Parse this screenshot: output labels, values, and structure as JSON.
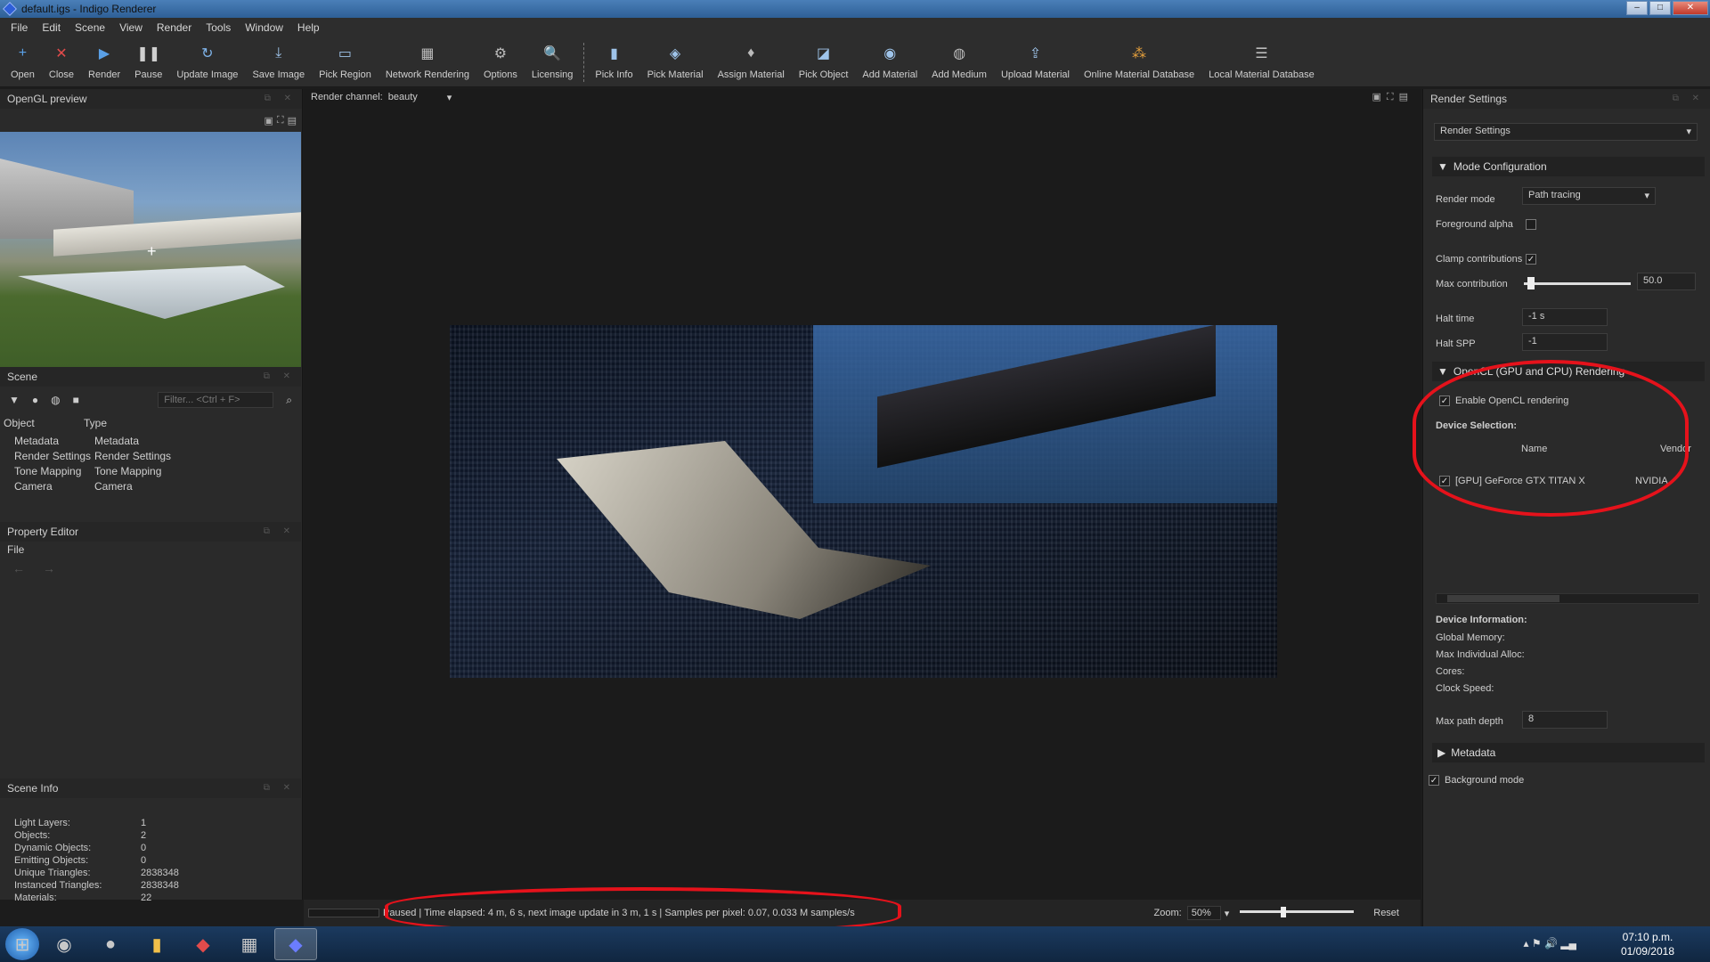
{
  "window": {
    "title": "default.igs - Indigo Renderer",
    "min": "–",
    "max": "□",
    "close": "✕"
  },
  "menu": [
    "File",
    "Edit",
    "Scene",
    "View",
    "Render",
    "Tools",
    "Window",
    "Help"
  ],
  "toolbar": [
    {
      "label": "Open",
      "icon": "plus-icon",
      "glyph": "+",
      "color": "#5aa0e6"
    },
    {
      "label": "Close",
      "icon": "close-icon",
      "glyph": "✕",
      "color": "#e24b4b"
    },
    {
      "label": "Render",
      "icon": "play-icon",
      "glyph": "▶",
      "color": "#5aa0e6"
    },
    {
      "label": "Pause",
      "icon": "pause-icon",
      "glyph": "❚❚",
      "color": "#cfcfcf"
    },
    {
      "label": "Update Image",
      "icon": "refresh-icon",
      "glyph": "↻",
      "color": "#7fb4ea"
    },
    {
      "label": "Save Image",
      "icon": "save-icon",
      "glyph": "⤓",
      "color": "#9fc4ea"
    },
    {
      "label": "Pick Region",
      "icon": "region-icon",
      "glyph": "▭",
      "color": "#9fc4ea"
    },
    {
      "label": "Network Rendering",
      "icon": "network-icon",
      "glyph": "▦",
      "color": "#bbb"
    },
    {
      "label": "Options",
      "icon": "gear-icon",
      "glyph": "⚙",
      "color": "#bbb"
    },
    {
      "label": "Licensing",
      "icon": "key-icon",
      "glyph": "🔍",
      "color": "#9fc4ea"
    },
    {
      "label": "Pick Info",
      "icon": "bar-chart-icon",
      "glyph": "▮",
      "color": "#9fc4ea"
    },
    {
      "label": "Pick Material",
      "icon": "material-icon",
      "glyph": "◈",
      "color": "#9fc4ea"
    },
    {
      "label": "Assign Material",
      "icon": "bucket-icon",
      "glyph": "♦",
      "color": "#bbb"
    },
    {
      "label": "Pick Object",
      "icon": "object-icon",
      "glyph": "◪",
      "color": "#9fc4ea"
    },
    {
      "label": "Add Material",
      "icon": "add-material-icon",
      "glyph": "◉",
      "color": "#9fc4ea"
    },
    {
      "label": "Add Medium",
      "icon": "add-medium-icon",
      "glyph": "◍",
      "color": "#bbb"
    },
    {
      "label": "Upload Material",
      "icon": "upload-icon",
      "glyph": "⇪",
      "color": "#9fc4ea"
    },
    {
      "label": "Online Material Database",
      "icon": "grid-icon",
      "glyph": "⁂",
      "color": "#e6a03c"
    },
    {
      "label": "Local Material Database",
      "icon": "database-icon",
      "glyph": "☰",
      "color": "#bbb"
    }
  ],
  "left": {
    "opengl_title": "OpenGL preview",
    "scene_title": "Scene",
    "filter_placeholder": "Filter... <Ctrl + F>",
    "scene_cols": [
      "Object",
      "Type"
    ],
    "scene_rows": [
      [
        "Metadata",
        "Metadata"
      ],
      [
        "Render Settings",
        "Render Settings"
      ],
      [
        "Tone Mapping",
        "Tone Mapping"
      ],
      [
        "Camera",
        "Camera"
      ]
    ],
    "property_title": "Property Editor",
    "property_file": "File",
    "sceneinfo_title": "Scene Info",
    "sceneinfo": [
      [
        "Light Layers:",
        "1"
      ],
      [
        "Objects:",
        "2"
      ],
      [
        "Dynamic Objects:",
        "0"
      ],
      [
        "Emitting Objects:",
        "0"
      ],
      [
        "Unique Triangles:",
        "2838348"
      ],
      [
        "Instanced Triangles:",
        "2838348"
      ],
      [
        "Materials:",
        "22"
      ]
    ]
  },
  "center": {
    "channel_label": "Render channel:",
    "channel_value": "beauty",
    "status": "Paused | Time elapsed: 4 m, 6 s, next image update in 3 m, 1 s | Samples per pixel: 0.07, 0.033 M samples/s",
    "zoom_label": "Zoom:",
    "zoom_value": "50%",
    "reset": "Reset"
  },
  "right": {
    "title": "Render Settings",
    "preset": "Render Settings",
    "mode_section": "Mode Configuration",
    "render_mode_label": "Render mode",
    "render_mode": "Path tracing",
    "fg_alpha_label": "Foreground alpha",
    "clamp_label": "Clamp contributions",
    "max_contrib_label": "Max contribution",
    "max_contrib": "50.0",
    "halt_time_label": "Halt time",
    "halt_time": "-1 s",
    "halt_spp_label": "Halt SPP",
    "halt_spp": "-1",
    "opencl_section": "OpenCL (GPU and CPU) Rendering",
    "enable_opencl": "Enable OpenCL rendering",
    "device_sel": "Device Selection:",
    "col_name": "Name",
    "col_vendor": "Vendor",
    "device_name": "[GPU] GeForce GTX TITAN X",
    "device_vendor": "NVIDIA",
    "devinfo_title": "Device Information:",
    "devinfo": [
      "Global Memory:",
      "Max Individual Alloc:",
      "Cores:",
      "Clock Speed:"
    ],
    "max_path_label": "Max path depth",
    "max_path": "8",
    "metadata_section": "Metadata",
    "bg_mode": "Background mode"
  },
  "taskbar": {
    "time": "07:10 p.m.",
    "date": "01/09/2018"
  },
  "colors": {
    "highlight": "#e5121b",
    "accent": "#5aa0e6"
  }
}
